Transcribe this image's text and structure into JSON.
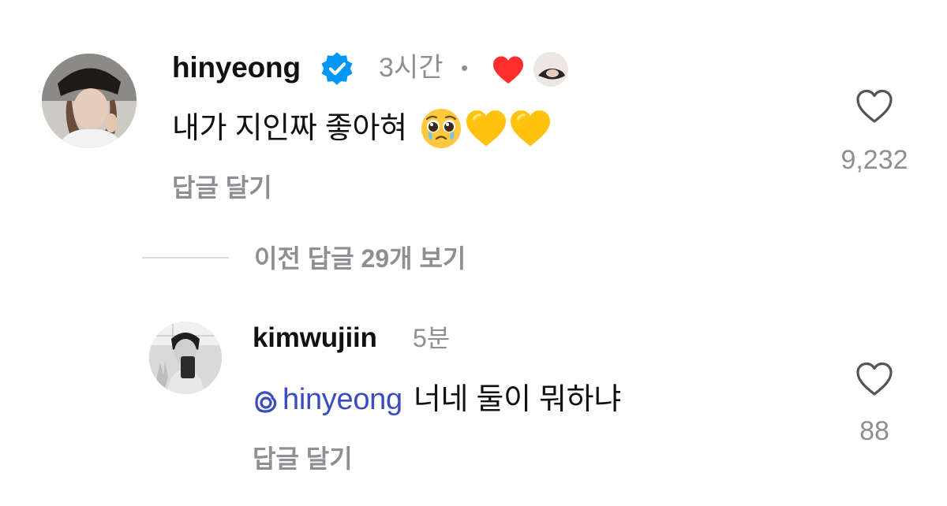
{
  "comments": [
    {
      "username": "hinyeong",
      "verified": true,
      "time": "3시간",
      "separator": "•",
      "text": "내가 지인짜 좋아혀",
      "emojis": [
        "pleading-face",
        "yellow-heart",
        "yellow-heart"
      ],
      "reply_label": "답글 달기",
      "like_count": "9,232",
      "author_liked": true
    }
  ],
  "view_replies": {
    "label": "이전 답글 29개 보기"
  },
  "replies": [
    {
      "username": "kimwujiin",
      "time": "5분",
      "mention": "hinyeong",
      "text": "너네 둘이 뭐하냐",
      "reply_label": "답글 달기",
      "like_count": "88"
    }
  ],
  "colors": {
    "verified_badge": "#0095f6",
    "heart_red": "#ff2d2d",
    "mention_blue": "#3b4cc0",
    "meta_gray": "#8e8e93"
  }
}
